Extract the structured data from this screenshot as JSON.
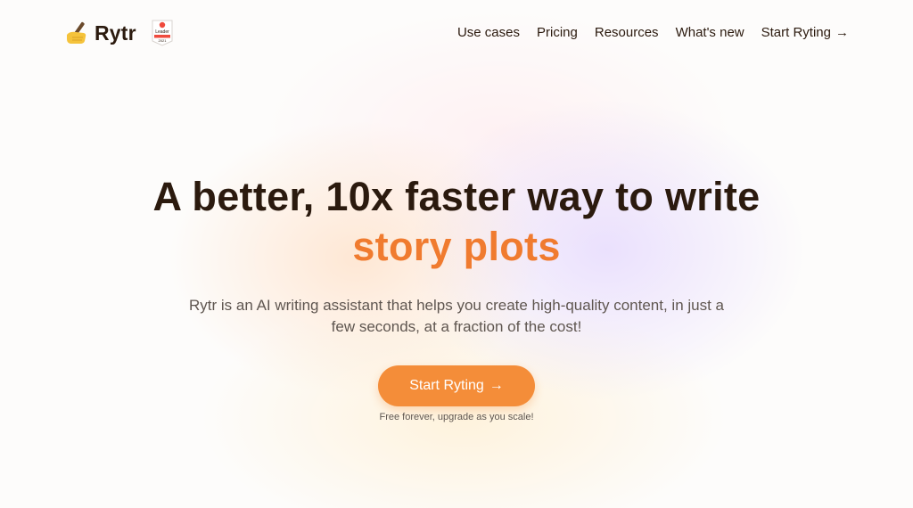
{
  "brand": {
    "name": "Rytr",
    "logo_icon": "writing-hand-icon",
    "badge_icon": "g2-leader-badge-icon",
    "badge_text": "Leader",
    "badge_year": "2021"
  },
  "nav": {
    "items": [
      {
        "label": "Use cases"
      },
      {
        "label": "Pricing"
      },
      {
        "label": "Resources"
      },
      {
        "label": "What's new"
      }
    ],
    "cta_label": "Start Ryting",
    "cta_icon": "arrow-right-icon",
    "arrow_glyph": "→"
  },
  "hero": {
    "headline": "A better, 10x faster way to write",
    "headline_accent": "story plots",
    "subtitle": "Rytr is an AI writing assistant that helps you create high-quality content, in just a few seconds, at a fraction of the cost!",
    "cta_label": "Start Ryting",
    "cta_note": "Free forever, upgrade as you scale!"
  },
  "colors": {
    "accent": "#f07b2f",
    "button": "#f48d39",
    "text": "#2b1a0e",
    "muted": "#5f5650"
  }
}
